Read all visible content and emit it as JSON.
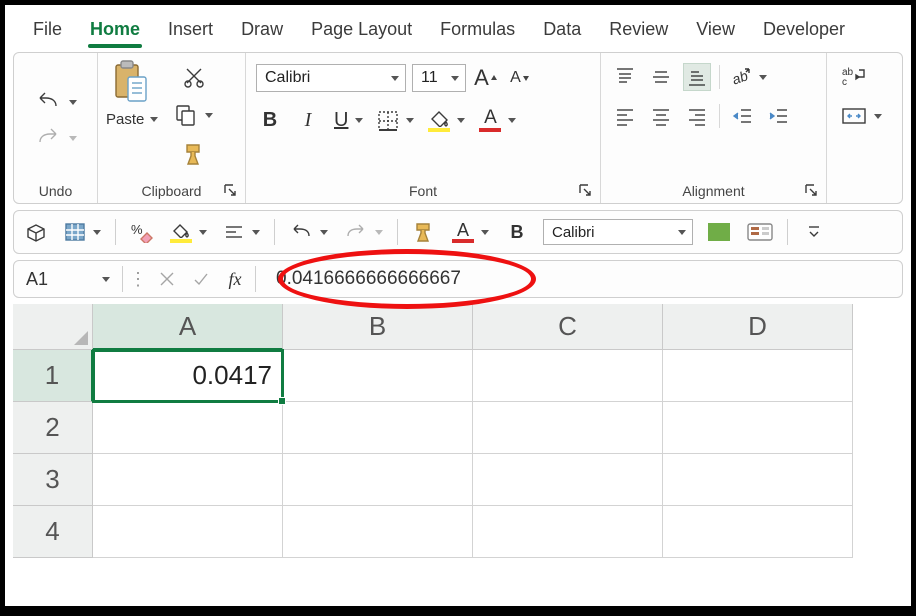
{
  "tabs": {
    "file": "File",
    "home": "Home",
    "insert": "Insert",
    "draw": "Draw",
    "page_layout": "Page Layout",
    "formulas": "Formulas",
    "data": "Data",
    "review": "Review",
    "view": "View",
    "developer": "Developer"
  },
  "ribbon": {
    "undo_group": "Undo",
    "clipboard_group": "Clipboard",
    "font_group": "Font",
    "alignment_group": "Alignment",
    "paste_label": "Paste",
    "font_name": "Calibri",
    "font_size": "11",
    "bold": "B",
    "italic": "I",
    "underline": "U",
    "font_grow": "A",
    "font_shrink": "A",
    "fontcolor_letter": "A",
    "qat_font": "Calibri",
    "qat_bold": "B",
    "qat_fontcolor_letter": "A"
  },
  "fbar": {
    "namebox": "A1",
    "fx": "fx",
    "value": "0.0416666666666667"
  },
  "grid": {
    "cols": [
      "A",
      "B",
      "C",
      "D"
    ],
    "rows": [
      "1",
      "2",
      "3",
      "4"
    ],
    "A1_display": "0.0417"
  },
  "colors": {
    "excel_green": "#107c41",
    "fill_highlight": "#ffeb3b",
    "font_color_red": "#d92b2b",
    "qat_fill": "#70ad47"
  }
}
